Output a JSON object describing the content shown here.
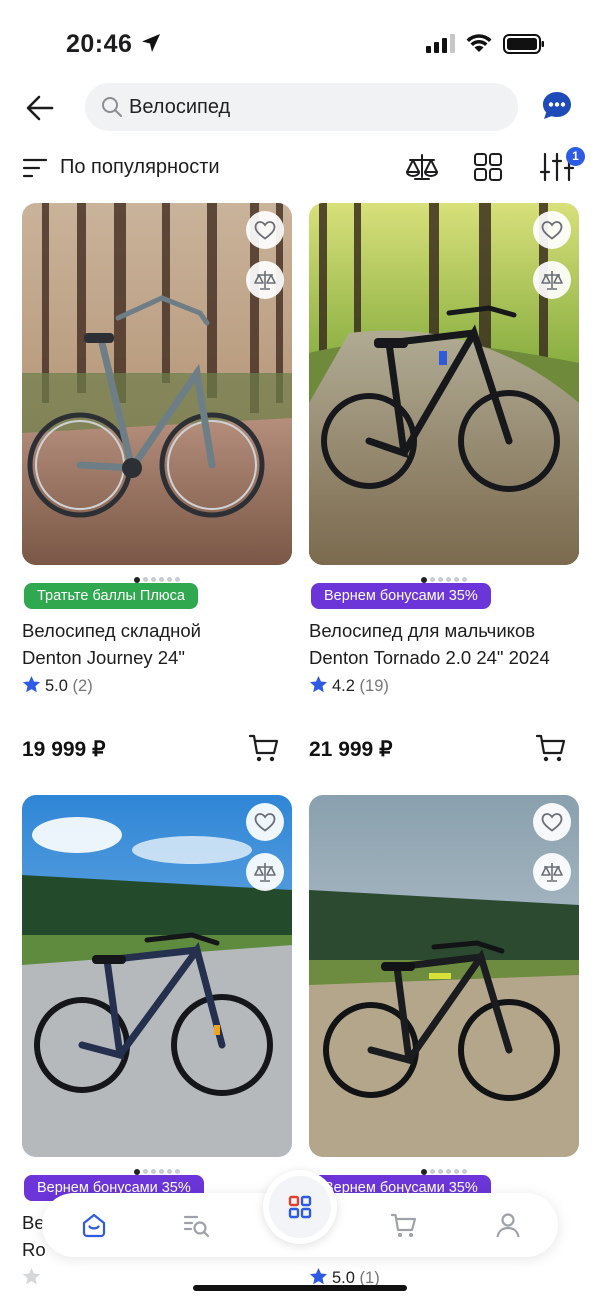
{
  "status_bar": {
    "time": "20:46"
  },
  "search": {
    "query": "Велосипед"
  },
  "sort": {
    "label": "По популярности",
    "filter_count": "1"
  },
  "products": [
    {
      "badge": "Тратьте баллы Плюса",
      "badge_color": "#2fa84f",
      "title_line1": "Велосипед складной",
      "title_line2": "Denton Journey 24\"",
      "rating": "5.0",
      "reviews": "(2)",
      "price": "19 999 ₽"
    },
    {
      "badge": "Вернем бонусами 35%",
      "badge_color": "#6b35d9",
      "title_line1": "Велосипед для мальчиков",
      "title_line2": "Denton Tornado 2.0 24\" 2024",
      "rating": "4.2",
      "reviews": "(19)",
      "price": "21 999 ₽"
    },
    {
      "badge": "Вернем бонусами 35%",
      "badge_color": "#6b35d9",
      "title_line1": "Ве",
      "title_line2": "Ro"
    },
    {
      "badge": "Вернем бонусами 35%",
      "badge_color": "#6b35d9",
      "title_line1": "е",
      "rating": "5.0",
      "reviews": "(1)"
    }
  ],
  "colors": {
    "accent": "#2d5be3",
    "star": "#2d5be3",
    "badge_green": "#2fa84f",
    "badge_purple": "#6b35d9"
  },
  "nav": {
    "items": [
      "home-icon",
      "catalog-search-icon",
      "catalog-grid-icon",
      "cart-icon",
      "profile-icon"
    ]
  }
}
